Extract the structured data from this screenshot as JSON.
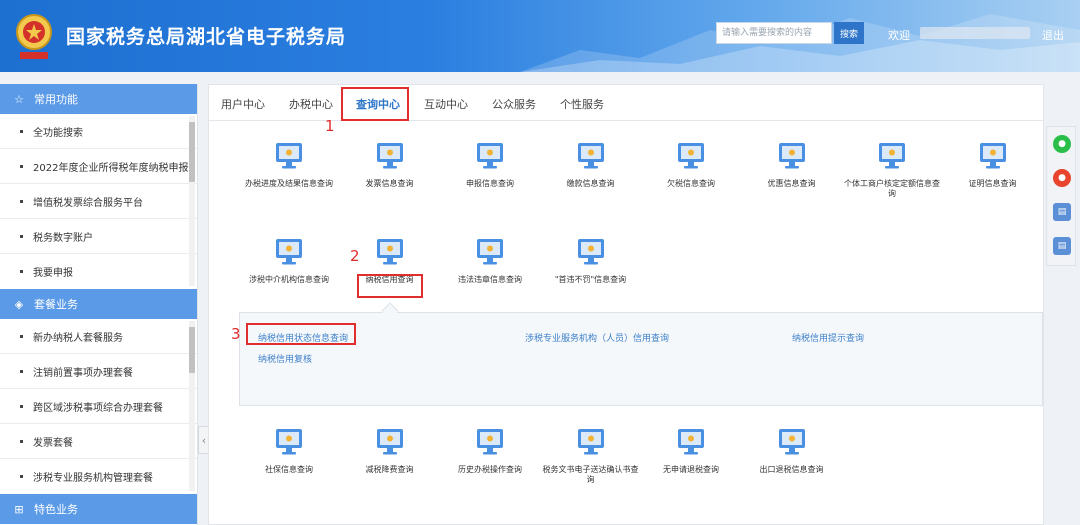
{
  "header": {
    "title": "国家税务总局湖北省电子税务局",
    "search_placeholder": "请输入需要搜索的内容",
    "search_button": "搜索",
    "welcome": "欢迎",
    "logout": "退出"
  },
  "sidebar": {
    "sections": [
      {
        "title": "常用功能",
        "icon": "star-icon",
        "items": [
          "全功能搜索",
          "2022年度企业所得税年度纳税申报",
          "增值税发票综合服务平台",
          "税务数字账户",
          "我要申报"
        ]
      },
      {
        "title": "套餐业务",
        "icon": "cube-icon",
        "items": [
          "新办纳税人套餐服务",
          "注销前置事项办理套餐",
          "跨区域涉税事项综合办理套餐",
          "发票套餐",
          "涉税专业服务机构管理套餐"
        ]
      },
      {
        "title": "特色业务",
        "icon": "grid-icon",
        "items": []
      }
    ]
  },
  "tabs": [
    "用户中心",
    "办税中心",
    "查询中心",
    "互动中心",
    "公众服务",
    "个性服务"
  ],
  "active_tab": "查询中心",
  "tiles_row1": [
    "办税进度及结果信息查询",
    "发票信息查询",
    "申报信息查询",
    "缴款信息查询",
    "欠税信息查询",
    "优惠信息查询",
    "个体工商户核定定额信息查询",
    "证明信息查询"
  ],
  "tiles_row2": [
    "涉税中介机构信息查询",
    "纳税信用查询",
    "违法违章信息查询",
    "\"首违不罚\"信息查询"
  ],
  "sub_links": [
    "纳税信用状态信息查询",
    "涉税专业服务机构（人员）信用查询",
    "纳税信用提示查询",
    "纳税信用复核"
  ],
  "tiles_row3": [
    "社保信息查询",
    "减税降费查询",
    "历史办税操作查询",
    "税务文书电子送达确认书查询",
    "无申请退税查询",
    "出口退税信息查询"
  ],
  "annotations": [
    "1",
    "2",
    "3"
  ],
  "colors": {
    "brand_blue": "#2b7fe0",
    "sidebar_head": "#5b9ae6",
    "highlight_red": "#e02d2d",
    "link_blue": "#3c7fc9"
  }
}
